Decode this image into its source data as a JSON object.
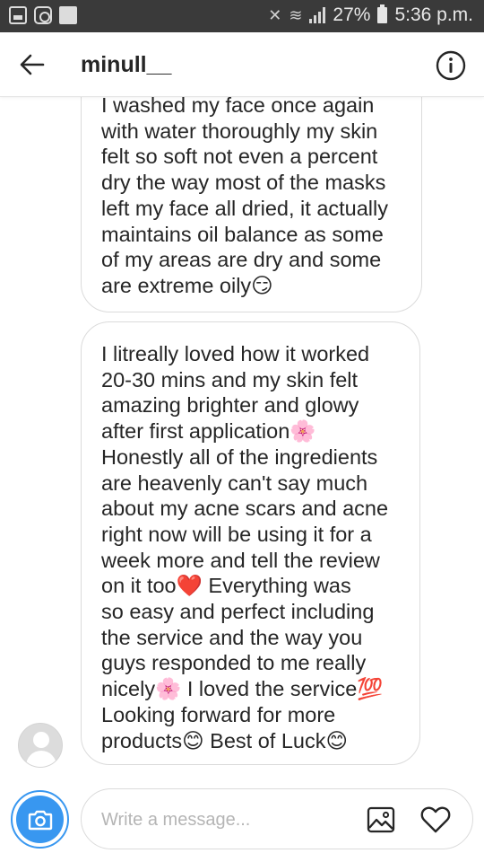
{
  "status_bar": {
    "left_icons": [
      "gallery-icon",
      "instagram-icon",
      "recycle-icon"
    ],
    "battery": "27%",
    "time": "5:36 p.m."
  },
  "header": {
    "title": "minull__",
    "back_icon": "arrow-left-icon",
    "info_icon": "info-icon"
  },
  "messages": [
    {
      "lines": [
        "I washed my face once again",
        "with water thoroughly my skin",
        "felt so soft not even a percent",
        "dry the way most of the masks",
        "left my face all dried, it actually",
        "maintains oil balance as some",
        "of my areas are dry and some",
        "are extreme oily😏"
      ]
    },
    {
      "lines": [
        "I litreally loved how it worked",
        "20-30 mins and my skin felt",
        "amazing brighter and glowy",
        "after first application🌸",
        "Honestly all of the ingredients",
        "are heavenly can't say much",
        "about my acne scars and acne",
        "right now will be using it for a",
        "week more and tell the review",
        "on it too❤️ Everything was",
        "so easy and perfect including",
        "the service and the way you",
        "guys responded to me really",
        "nicely🌸 I loved the service💯",
        "Looking forward for more",
        "products😊 Best of Luck😊"
      ]
    }
  ],
  "composer": {
    "placeholder": "Write a message...",
    "camera_icon": "camera-icon",
    "gallery_icon": "image-icon",
    "like_icon": "heart-icon"
  },
  "colors": {
    "status_bar_bg": "#3a3a3a",
    "accent_blue": "#3897f0",
    "bubble_border": "#dbdbdb",
    "text": "#262626"
  }
}
